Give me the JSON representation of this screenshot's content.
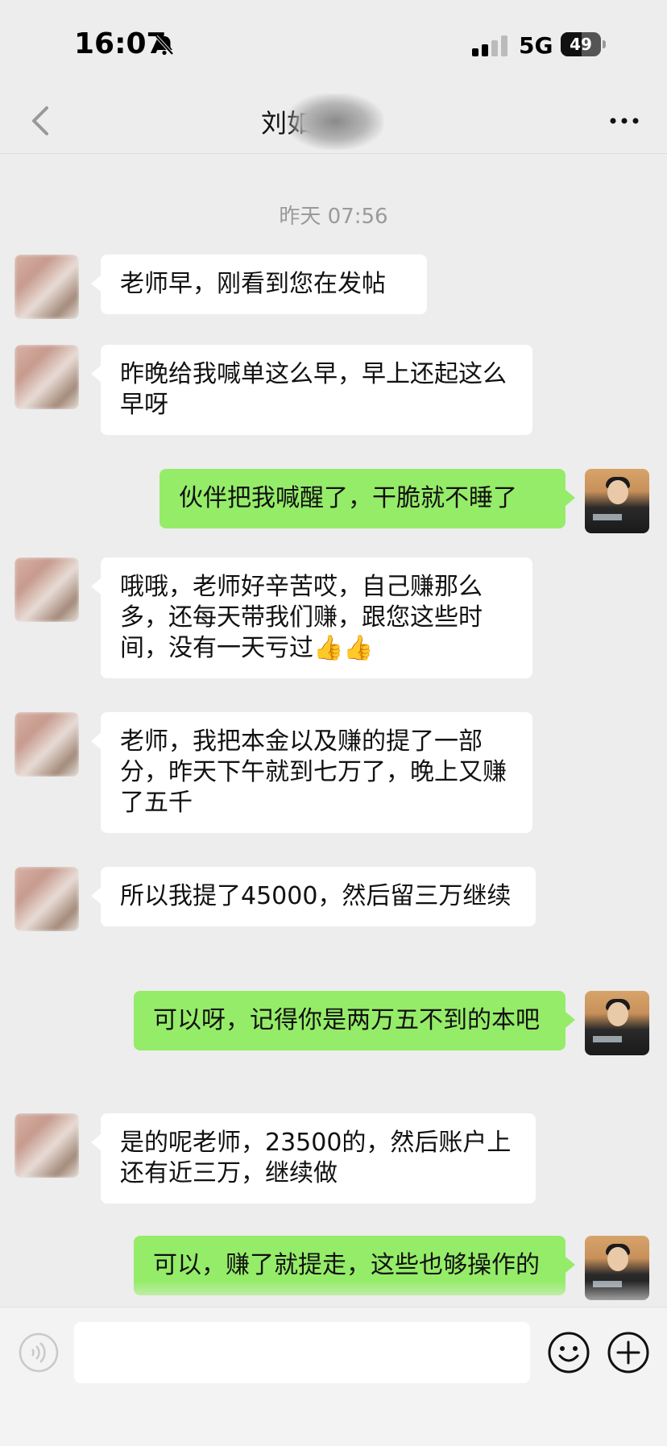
{
  "status_bar": {
    "time": "16:07",
    "network": "5G",
    "battery_level": "49",
    "icons": [
      "bell-off-icon",
      "signal-icon",
      "battery-icon"
    ]
  },
  "nav": {
    "title": "刘如",
    "icons": [
      "chevron-left-icon",
      "more-horizontal-icon"
    ]
  },
  "chat": {
    "timestamp": "昨天 07:56",
    "messages": [
      {
        "from": "contact",
        "text": "老师早，刚看到您在发帖"
      },
      {
        "from": "contact",
        "text": "昨晚给我喊单这么早，早上还起这么早呀"
      },
      {
        "from": "self",
        "text": "伙伴把我喊醒了，干脆就不睡了"
      },
      {
        "from": "contact",
        "text": "哦哦，老师好辛苦哎，自己赚那么多，还每天带我们赚，跟您这些时间，没有一天亏过👍👍"
      },
      {
        "from": "contact",
        "text": "老师，我把本金以及赚的提了一部分，昨天下午就到七万了，晚上又赚了五千"
      },
      {
        "from": "contact",
        "text": "所以我提了45000，然后留三万继续"
      },
      {
        "from": "self",
        "text": "可以呀，记得你是两万五不到的本吧"
      },
      {
        "from": "contact",
        "text": "是的呢老师，23500的，然后账户上还有近三万，继续做"
      },
      {
        "from": "self",
        "text": "可以，赚了就提走，这些也够操作的"
      }
    ]
  },
  "input_bar": {
    "placeholder": "",
    "icons": [
      "voice-icon",
      "emoji-icon",
      "plus-icon"
    ]
  },
  "colors": {
    "background": "#ededed",
    "outgoing_bubble": "#95ec69",
    "incoming_bubble": "#ffffff",
    "timestamp": "#9a9a9a"
  }
}
